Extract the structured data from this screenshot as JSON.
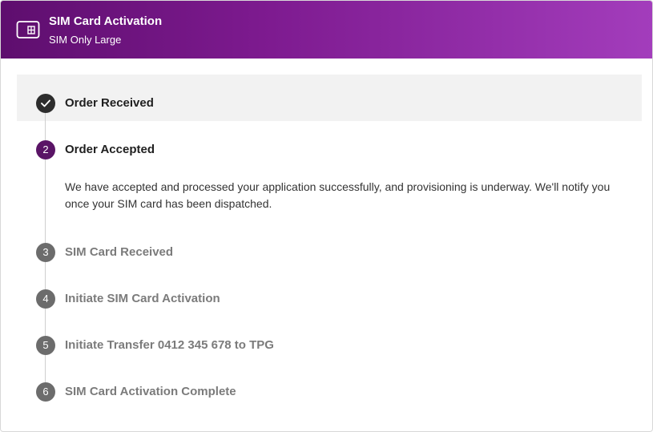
{
  "header": {
    "title": "SIM Card Activation",
    "subtitle": "SIM Only Large",
    "icon": "sim-card-icon"
  },
  "colors": {
    "header_gradient_start": "#5e0e6e",
    "header_gradient_end": "#a33dbc",
    "completed_step": "#2d2d2d",
    "active_step": "#5a1466",
    "pending_step": "#6c6c6c",
    "highlight_background": "#f2f2f2"
  },
  "steps": [
    {
      "marker": "",
      "marker_icon": "checkmark-icon",
      "label": "Order Received",
      "status": "completed"
    },
    {
      "marker": "2",
      "label": "Order Accepted",
      "status": "active",
      "description": "We have accepted and processed your application successfully, and provisioning is underway. We'll notify you once your SIM card has been dispatched."
    },
    {
      "marker": "3",
      "label": "SIM Card Received",
      "status": "pending"
    },
    {
      "marker": "4",
      "label": "Initiate SIM Card Activation",
      "status": "pending"
    },
    {
      "marker": "5",
      "label": "Initiate Transfer 0412 345 678 to TPG",
      "status": "pending"
    },
    {
      "marker": "6",
      "label": "SIM Card Activation Complete",
      "status": "pending"
    }
  ]
}
